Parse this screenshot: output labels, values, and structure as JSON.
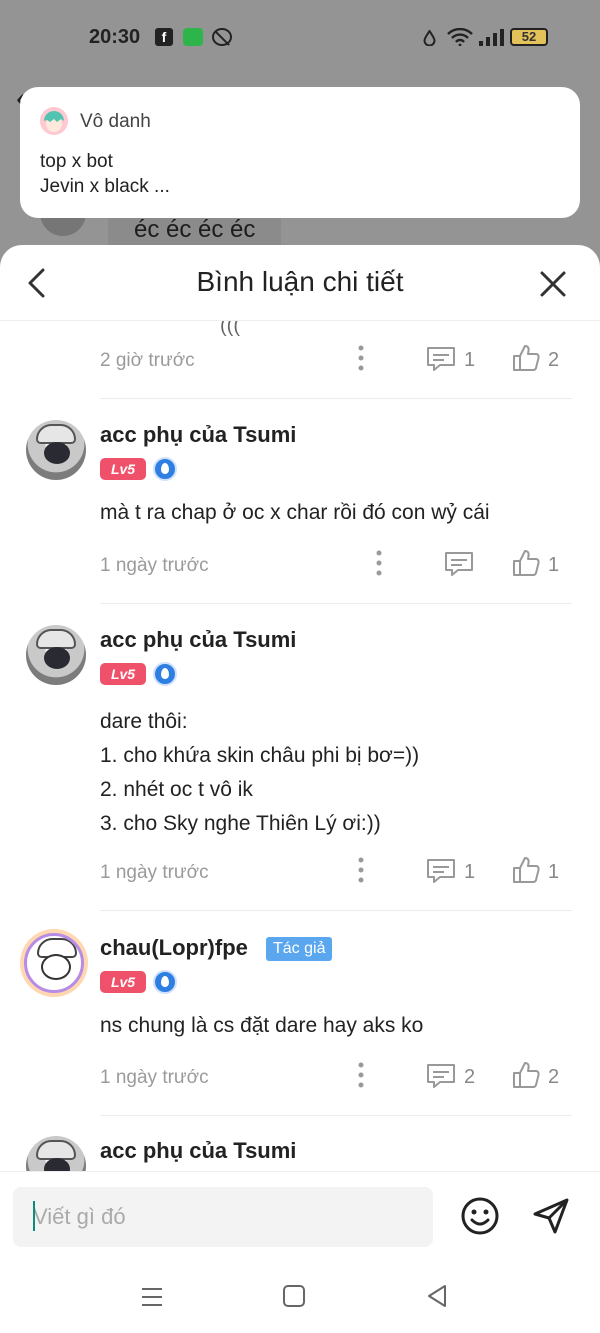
{
  "status_bar": {
    "time": "20:30",
    "battery": "52",
    "icons": [
      "facebook-icon",
      "messages-icon",
      "dnd-icon",
      "drop-icon",
      "wifi-icon",
      "signal-icon",
      "battery-icon"
    ]
  },
  "background": {
    "comment_text": "éc éc éc éc"
  },
  "popup": {
    "name": "Vô danh",
    "line1": "top x bot",
    "line2": "Jevin x black ..."
  },
  "sheet": {
    "title": "Bình luận chi tiết",
    "cut_text": "((("
  },
  "comments": [
    {
      "time": "2 giờ trước",
      "reply_count": "1",
      "like_count": "2"
    },
    {
      "name": "acc phụ của Tsumi",
      "level": "Lv5",
      "text": "mà t ra chap ở oc x char rồi đó con wỷ cái",
      "time": "1 ngày trước",
      "reply_count": "",
      "like_count": "1"
    },
    {
      "name": "acc phụ của Tsumi",
      "level": "Lv5",
      "text": "dare thôi:\n1. cho khứa skin châu phi bị bơ=))\n2. nhét oc t vô ik\n3. cho Sky nghe Thiên Lý ơi:))",
      "time": "1 ngày trước",
      "reply_count": "1",
      "like_count": "1"
    },
    {
      "name": "chau(Lopr)fpe",
      "author_badge": "Tác giả",
      "level": "Lv5",
      "text": "ns chung là cs đặt dare hay aks ko",
      "time": "1 ngày trước",
      "reply_count": "2",
      "like_count": "2"
    },
    {
      "name": "acc phụ của Tsumi"
    }
  ],
  "input": {
    "placeholder": "Viết gì đó"
  },
  "colors": {
    "level_badge": "#f0516a",
    "author_badge": "#5aa7ef",
    "caret": "#0f8d78"
  }
}
